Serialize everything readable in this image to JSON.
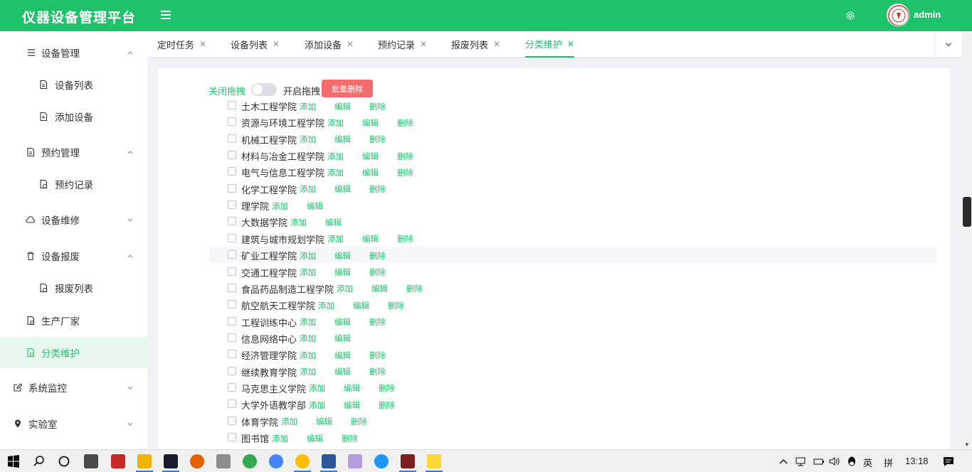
{
  "header": {
    "app_title": "仪器设备管理平台",
    "user_name": "admin",
    "accent_color": "#1ec26b"
  },
  "sidebar": {
    "items": [
      {
        "label": "设备管理",
        "icon": "list-icon",
        "expanded": true
      },
      {
        "label": "设备列表",
        "icon": "document-icon"
      },
      {
        "label": "添加设备",
        "icon": "document-add-icon"
      },
      {
        "label": "预约管理",
        "icon": "document-icon",
        "expanded": true
      },
      {
        "label": "预约记录",
        "icon": "document-clock-icon"
      },
      {
        "label": "设备维修",
        "icon": "cloud-icon",
        "expanded": false
      },
      {
        "label": "设备报废",
        "icon": "trash-icon",
        "expanded": true
      },
      {
        "label": "报废列表",
        "icon": "document-clock-icon"
      },
      {
        "label": "生产厂家",
        "icon": "document-gear-icon"
      },
      {
        "label": "分类维护",
        "icon": "document-gear-icon",
        "active": true
      },
      {
        "label": "系统监控",
        "icon": "edit-icon",
        "expanded": false
      },
      {
        "label": "实验室",
        "icon": "location-icon",
        "expanded": false
      }
    ]
  },
  "tabs": [
    {
      "label": "定时任务"
    },
    {
      "label": "设备列表"
    },
    {
      "label": "添加设备"
    },
    {
      "label": "预约记录"
    },
    {
      "label": "报废列表"
    },
    {
      "label": "分类维护",
      "active": true
    }
  ],
  "toolbar": {
    "drag_off_label": "关闭拖拽",
    "drag_on_label": "开启拖拽",
    "batch_delete_label": "批量删除"
  },
  "ops": {
    "add": "添加",
    "edit": "编辑",
    "delete": "删除"
  },
  "tree": [
    {
      "label": "土木工程学院",
      "ops": [
        "add",
        "edit",
        "delete"
      ]
    },
    {
      "label": "资源与环境工程学院",
      "ops": [
        "add",
        "edit",
        "delete"
      ]
    },
    {
      "label": "机械工程学院",
      "ops": [
        "add",
        "edit",
        "delete"
      ]
    },
    {
      "label": "材料与冶金工程学院",
      "ops": [
        "add",
        "edit",
        "delete"
      ]
    },
    {
      "label": "电气与信息工程学院",
      "ops": [
        "add",
        "edit",
        "delete"
      ]
    },
    {
      "label": "化学工程学院",
      "ops": [
        "add",
        "edit",
        "delete"
      ]
    },
    {
      "label": "理学院",
      "ops": [
        "add",
        "edit"
      ]
    },
    {
      "label": "大数据学院",
      "ops": [
        "add",
        "edit"
      ]
    },
    {
      "label": "建筑与城市规划学院",
      "ops": [
        "add",
        "edit",
        "delete"
      ]
    },
    {
      "label": "矿业工程学院",
      "ops": [
        "add",
        "edit",
        "delete"
      ],
      "hover": true
    },
    {
      "label": "交通工程学院",
      "ops": [
        "add",
        "edit",
        "delete"
      ]
    },
    {
      "label": "食品药品制造工程学院",
      "ops": [
        "add",
        "edit",
        "delete"
      ]
    },
    {
      "label": "航空航天工程学院",
      "ops": [
        "add",
        "edit",
        "delete"
      ]
    },
    {
      "label": "工程训练中心",
      "ops": [
        "add",
        "edit",
        "delete"
      ]
    },
    {
      "label": "信息网络中心",
      "ops": [
        "add",
        "edit"
      ]
    },
    {
      "label": "经济管理学院",
      "ops": [
        "add",
        "edit",
        "delete"
      ]
    },
    {
      "label": "继续教育学院",
      "ops": [
        "add",
        "edit",
        "delete"
      ]
    },
    {
      "label": "马克思主义学院",
      "ops": [
        "add",
        "edit",
        "delete"
      ]
    },
    {
      "label": "大学外语教学部",
      "ops": [
        "add",
        "edit",
        "delete"
      ]
    },
    {
      "label": "体育学院",
      "ops": [
        "add",
        "edit",
        "delete"
      ]
    },
    {
      "label": "图书馆",
      "ops": [
        "add",
        "edit",
        "delete"
      ]
    }
  ],
  "taskbar": {
    "ime_lang": "英",
    "ime_mode": "拼",
    "time": "13:18"
  }
}
